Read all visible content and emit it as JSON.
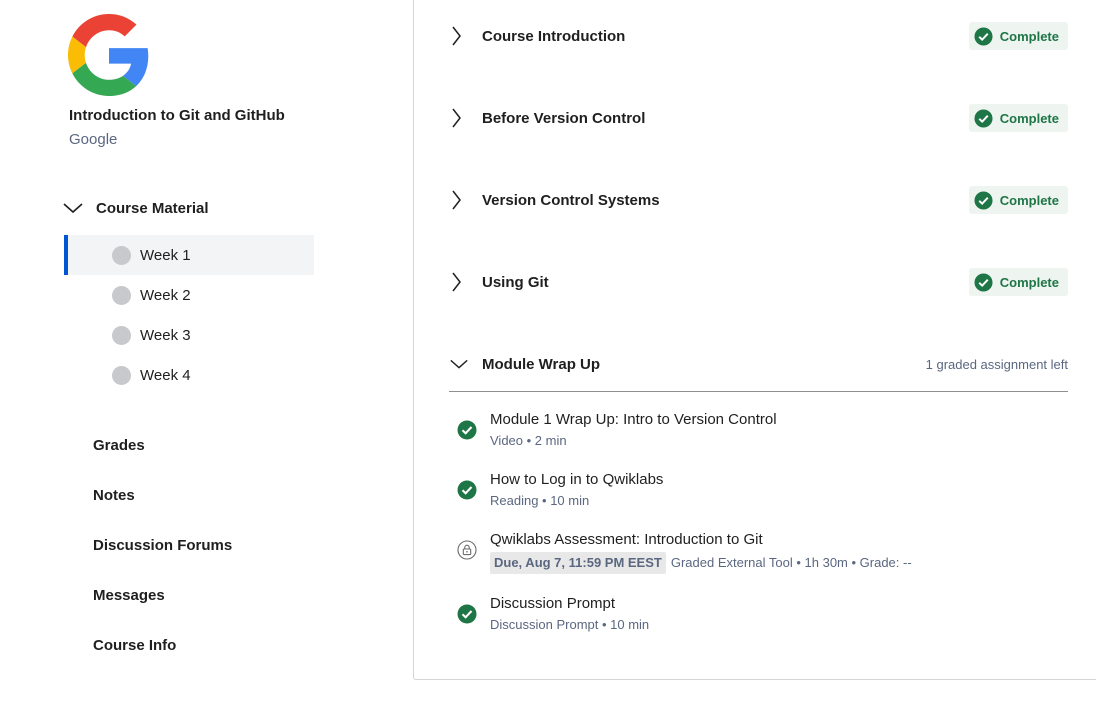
{
  "sidebar": {
    "logo_icon": "google-g-logo",
    "course_title": "Introduction to Git and GitHub",
    "partner": "Google",
    "course_material_label": "Course Material",
    "weeks": [
      {
        "label": "Week 1",
        "active": true
      },
      {
        "label": "Week 2",
        "active": false
      },
      {
        "label": "Week 3",
        "active": false
      },
      {
        "label": "Week 4",
        "active": false
      }
    ],
    "nav_items": [
      "Grades",
      "Notes",
      "Discussion Forums",
      "Messages",
      "Course Info"
    ]
  },
  "main": {
    "modules": [
      {
        "title": "Course Introduction",
        "status": "Complete"
      },
      {
        "title": "Before Version Control",
        "status": "Complete"
      },
      {
        "title": "Version Control Systems",
        "status": "Complete"
      },
      {
        "title": "Using Git",
        "status": "Complete"
      }
    ],
    "expanded_module": {
      "title": "Module Wrap Up",
      "remaining": "1 graded assignment left",
      "items": [
        {
          "name": "Module 1 Wrap Up: Intro to Version Control",
          "meta": "Video • 2 min",
          "state": "complete"
        },
        {
          "name": "How to Log in to Qwiklabs",
          "meta": "Reading • 10 min",
          "state": "complete"
        },
        {
          "name": "Qwiklabs Assessment: Introduction to Git",
          "due": "Due, Aug 7, 11:59 PM EEST",
          "meta": "Graded External Tool • 1h 30m • Grade: --",
          "state": "locked"
        },
        {
          "name": "Discussion Prompt",
          "meta": "Discussion Prompt • 10 min",
          "state": "complete"
        }
      ]
    }
  },
  "colors": {
    "accent": "#0056d2",
    "success": "#1e7546",
    "badge_bg": "#eef5f0",
    "muted_text": "#5b6780"
  }
}
